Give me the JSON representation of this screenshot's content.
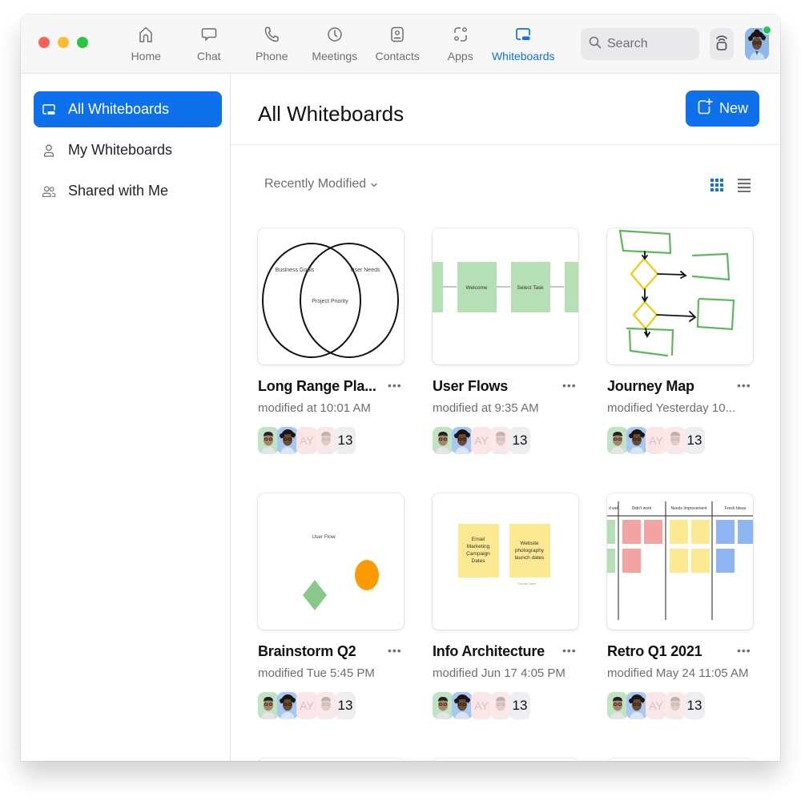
{
  "window": {
    "traffic_lights": [
      "close",
      "minimize",
      "zoom"
    ]
  },
  "nav": {
    "items": [
      {
        "label": "Home",
        "icon": "home-icon",
        "active": false
      },
      {
        "label": "Chat",
        "icon": "chat-icon",
        "active": false
      },
      {
        "label": "Phone",
        "icon": "phone-icon",
        "active": false
      },
      {
        "label": "Meetings",
        "icon": "clock-icon",
        "active": false
      },
      {
        "label": "Contacts",
        "icon": "contacts-icon",
        "active": false
      },
      {
        "label": "Apps",
        "icon": "apps-icon",
        "active": false
      },
      {
        "label": "Whiteboards",
        "icon": "whiteboard-icon",
        "active": true
      }
    ],
    "search_placeholder": "Search",
    "presence_status": "online"
  },
  "sidebar": {
    "items": [
      {
        "label": "All Whiteboards",
        "icon": "whiteboard-icon",
        "active": true
      },
      {
        "label": "My Whiteboards",
        "icon": "person-icon",
        "active": false
      },
      {
        "label": "Shared with Me",
        "icon": "people-icon",
        "active": false
      }
    ]
  },
  "main": {
    "title": "All Whiteboards",
    "new_button": "New",
    "sort_label": "Recently Modified",
    "view_mode": "grid",
    "cards": [
      {
        "title": "Long Range Pla...",
        "subtitle": "modified at 10:01 AM",
        "thumbnail": "venn",
        "thumb_text": [
          "Business Goals",
          "User Needs",
          "Project Priority"
        ],
        "avatar_initials": "AY",
        "collaborator_count": "13"
      },
      {
        "title": "User Flows",
        "subtitle": "modified at 9:35 AM",
        "thumbnail": "flow",
        "thumb_text": [
          "Welcome",
          "Select Task"
        ],
        "avatar_initials": "AY",
        "collaborator_count": "13"
      },
      {
        "title": "Journey Map",
        "subtitle": "modified Yesterday 10...",
        "thumbnail": "sketch",
        "thumb_text": [],
        "avatar_initials": "AY",
        "collaborator_count": "13"
      },
      {
        "title": "Brainstorm Q2",
        "subtitle": "modified Tue 5:45 PM",
        "thumbnail": "shapes",
        "thumb_text": [
          "User Flow"
        ],
        "avatar_initials": "AY",
        "collaborator_count": "13"
      },
      {
        "title": "Info Architecture",
        "subtitle": "modified Jun 17 4:05 PM",
        "thumbnail": "stickies",
        "thumb_text": [
          "Email Marketing Campaign Dates",
          "Website photography launch dates",
          "Thomas Fisher"
        ],
        "avatar_initials": "AY",
        "collaborator_count": "13"
      },
      {
        "title": "Retro Q1 2021",
        "subtitle": "modified May 24 11:05 AM",
        "thumbnail": "retro",
        "thumb_text": [
          "d well",
          "Didn't work",
          "Needs Improvement",
          "Fresh Ideas"
        ],
        "avatar_initials": "AY",
        "collaborator_count": "13"
      }
    ]
  },
  "colors": {
    "accent": "#0e71eb",
    "sticky_green": "#b5dfb5",
    "sticky_yellow": "#fde992",
    "sticky_red": "#f4a3a3",
    "sticky_blue": "#8fb4f2",
    "orange": "#ff9900",
    "presence": "#23c552"
  }
}
